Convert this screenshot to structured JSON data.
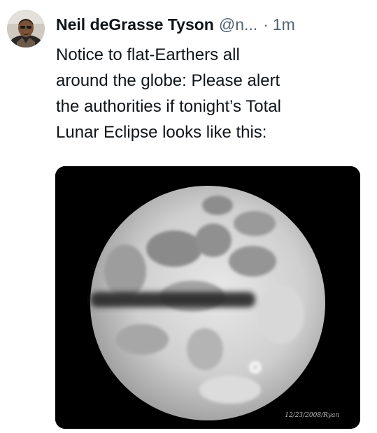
{
  "tweet": {
    "author": {
      "display_name": "Neil deGrasse Tyson",
      "handle": "@n...",
      "avatar_icon": "profile-avatar"
    },
    "separator": "·",
    "timestamp": "1m",
    "text": "Notice to flat-Earthers all\naround the globe: Please alert\nthe authorities if tonight’s Total\nLunar Eclipse looks like this:",
    "media": {
      "kind": "image",
      "description_icon": "full-moon-image",
      "watermark": "12/23/2008/Ryan"
    }
  },
  "colors": {
    "text_primary": "#0f1419",
    "text_secondary": "#536471",
    "background": "#ffffff",
    "media_background": "#000000"
  }
}
